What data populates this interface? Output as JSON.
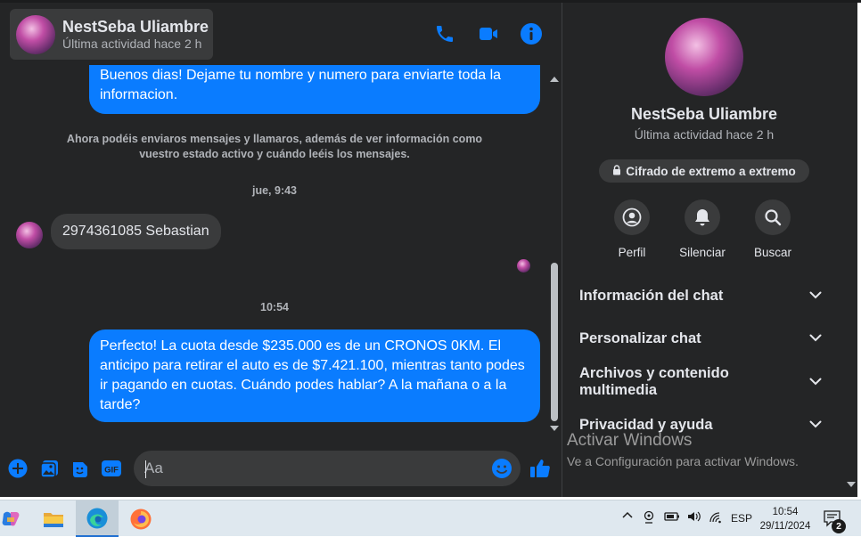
{
  "chat": {
    "contact_name": "NestSeba Uliambre",
    "contact_status": "Última actividad hace 2 h",
    "messages": [
      {
        "direction": "outgoing",
        "text": "Buenos dias! Dejame tu nombre y  numero para enviarte toda la informacion."
      },
      {
        "direction": "system",
        "text": "Ahora podéis enviaros mensajes y llamaros, además de ver información como vuestro estado activo y cuándo leéis los mensajes."
      },
      {
        "direction": "timestamp",
        "text": "jue, 9:43"
      },
      {
        "direction": "incoming",
        "text": "2974361085 Sebastian"
      },
      {
        "direction": "timestamp",
        "text": "10:54"
      },
      {
        "direction": "outgoing",
        "text": "Perfecto! La cuota desde $235.000 es de un CRONOS 0KM. El anticipo para retirar el auto es de $7.421.100, mientras tanto podes ir pagando en cuotas. Cuándo podes hablar? A la mañana o a la tarde?"
      }
    ],
    "composer_placeholder": "Aa",
    "composer_icons": [
      "plus-icon",
      "image-icon",
      "sticker-icon",
      "gif-icon",
      "emoji-icon",
      "like-icon"
    ],
    "header_icons": [
      "phone-icon",
      "video-icon",
      "info-icon"
    ]
  },
  "info_panel": {
    "name": "NestSeba Uliambre",
    "status": "Última actividad hace 2 h",
    "encryption_label": "Cifrado de extremo a extremo",
    "actions": [
      {
        "label": "Perfil",
        "icon": "profile-icon"
      },
      {
        "label": "Silenciar",
        "icon": "bell-icon"
      },
      {
        "label": "Buscar",
        "icon": "search-icon"
      }
    ],
    "sections": [
      {
        "label": "Información del chat"
      },
      {
        "label": "Personalizar chat"
      },
      {
        "label": "Archivos y contenido multimedia"
      },
      {
        "label": "Privacidad y ayuda"
      }
    ]
  },
  "watermark": {
    "title": "Activar Windows",
    "subtitle": "Ve a Configuración para activar Windows."
  },
  "taskbar": {
    "apps": [
      "copilot-icon",
      "file-explorer-icon",
      "edge-icon",
      "firefox-icon"
    ],
    "language": "ESP",
    "time": "10:54",
    "date": "29/11/2024",
    "notification_count": "2"
  },
  "colors": {
    "background": "#242526",
    "outgoing_bubble": "#0a7cff",
    "incoming_bubble": "#3a3b3c",
    "accent": "#0a7cff",
    "text_primary": "#e4e6eb",
    "text_secondary": "#b0b3b8"
  }
}
